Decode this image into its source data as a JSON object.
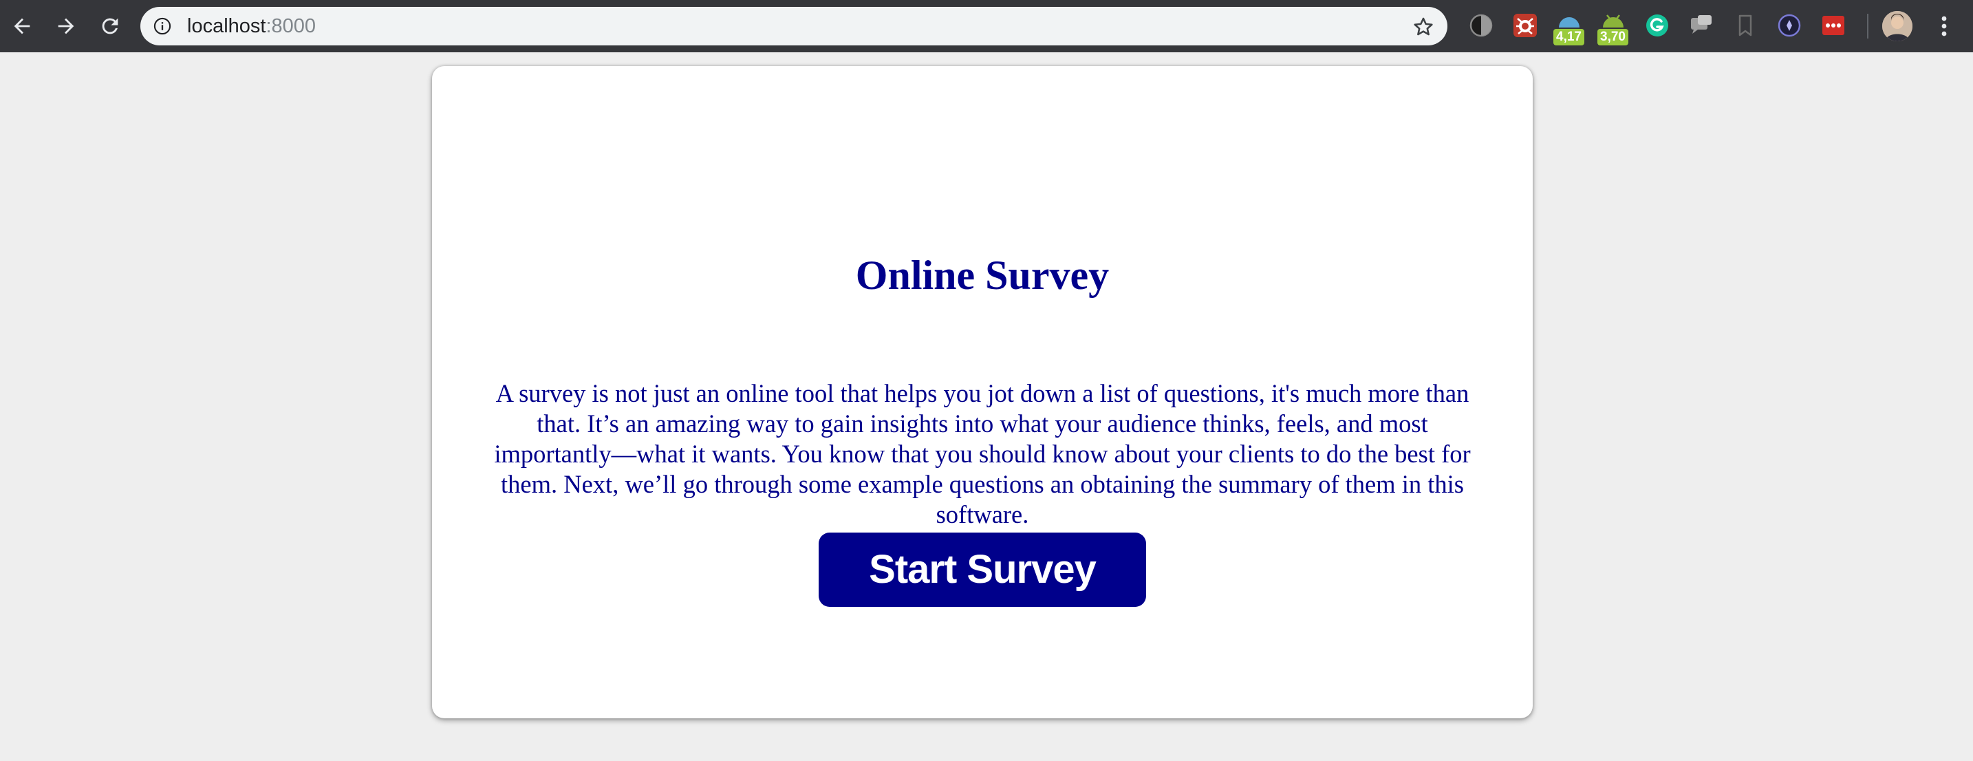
{
  "browser": {
    "back_icon": "arrow-left-icon",
    "forward_icon": "arrow-right-icon",
    "reload_icon": "reload-icon",
    "address": {
      "host": "localhost",
      "port": ":8000",
      "info_icon": "info-icon",
      "bookmark_icon": "star-icon"
    },
    "extensions": [
      {
        "name": "dark-mode-extension-icon"
      },
      {
        "name": "bug-extension-icon"
      },
      {
        "name": "weather-extension-icon",
        "badge": "4,17"
      },
      {
        "name": "android-extension-icon",
        "badge": "3,70"
      },
      {
        "name": "grammarly-extension-icon"
      },
      {
        "name": "chat-extension-icon"
      },
      {
        "name": "bookmark-extension-icon"
      },
      {
        "name": "compass-extension-icon"
      },
      {
        "name": "lastpass-extension-icon"
      }
    ],
    "profile_icon": "profile-avatar",
    "menu_icon": "kebab-menu-icon",
    "colors": {
      "chrome_bg": "#35363a",
      "omnibox_bg": "#f1f3f4",
      "badge": "#9acb3c"
    }
  },
  "page": {
    "title": "Online Survey",
    "description": "A survey is not just an online tool that helps you jot down a list of questions, it's much more than that. It’s an amazing way to gain insights into what your audience thinks, feels, and most importantly—what it wants. You know that you should know about your clients to do the best for them. Next, we’ll go through some example questions an obtaining the summary of them in this software.",
    "start_button_label": "Start Survey",
    "colors": {
      "accent": "#00008b",
      "background": "#eeeeee",
      "card": "#ffffff"
    }
  }
}
